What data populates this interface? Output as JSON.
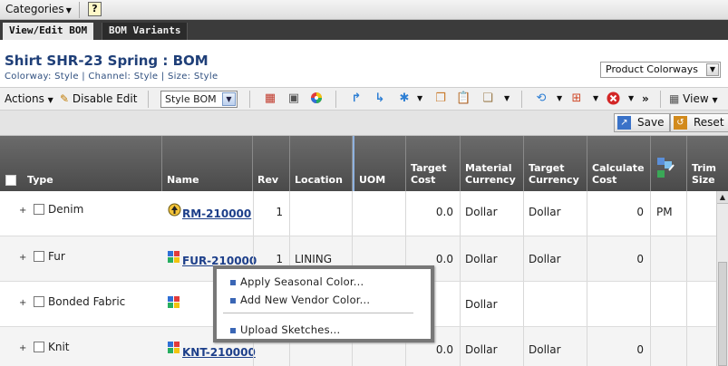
{
  "topbar": {
    "categories_label": "Categories",
    "help_label": "?"
  },
  "tabs": [
    {
      "label": "View/Edit BOM"
    },
    {
      "label": "BOM Variants"
    }
  ],
  "header": {
    "title": "Shirt SHR-23 Spring : BOM",
    "subtitle": "Colorway: Style | Channel: Style | Size: Style",
    "view_select": "Product Colorways"
  },
  "toolbar": {
    "actions_label": "Actions",
    "disable_edit_label": "Disable Edit",
    "bom_select": "Style BOM",
    "view_label": "View",
    "more_label": "»"
  },
  "actions": {
    "save_label": "Save",
    "reset_label": "Reset"
  },
  "columns": [
    "Type",
    "Name",
    "Rev",
    "Location",
    "UOM",
    "Target Cost",
    "Material Currency",
    "Target Currency",
    "Calculate Cost",
    "",
    "Trim Size"
  ],
  "rows": [
    {
      "type": "Denim",
      "name": "RM-210000",
      "rev": "1",
      "location": "",
      "uom": "",
      "target_cost": "0.0",
      "material_currency": "Dollar",
      "target_currency": "Dollar",
      "calc_cost": "0",
      "extra": "PM"
    },
    {
      "type": "Fur",
      "name": "FUR-210000",
      "rev": "1",
      "location": "LINING",
      "uom": "",
      "target_cost": "0.0",
      "material_currency": "Dollar",
      "target_currency": "Dollar",
      "calc_cost": "0",
      "extra": ""
    },
    {
      "type": "Bonded Fabric",
      "name": "",
      "rev": "",
      "location": "",
      "uom": "",
      "target_cost": "",
      "material_currency": "Dollar",
      "target_currency": "",
      "calc_cost": "",
      "extra": ""
    },
    {
      "type": "Knit",
      "name": "KNT-210000",
      "rev": "",
      "location": "",
      "uom": "",
      "target_cost": "0.0",
      "material_currency": "Dollar",
      "target_currency": "Dollar",
      "calc_cost": "0",
      "extra": ""
    }
  ],
  "context_menu": {
    "items": [
      "Apply Seasonal Color...",
      "Add New Vendor Color...",
      "Upload Sketches..."
    ]
  }
}
